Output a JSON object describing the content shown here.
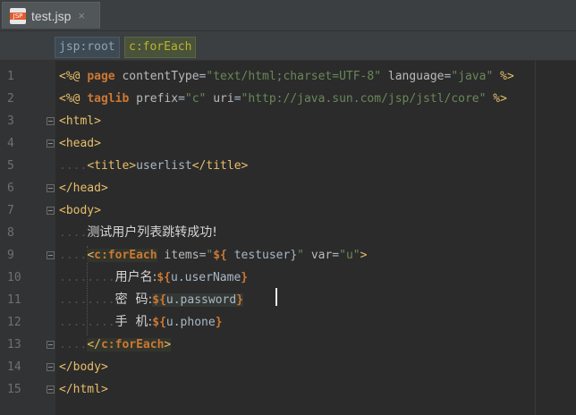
{
  "tab": {
    "file_icon_badge": "JSP",
    "filename": "test.jsp",
    "close": "×"
  },
  "breadcrumbs": [
    "jsp:root",
    "c:forEach"
  ],
  "line_numbers": [
    "1",
    "2",
    "3",
    "4",
    "5",
    "6",
    "7",
    "8",
    "9",
    "10",
    "11",
    "12",
    "13",
    "14",
    "15"
  ],
  "code": {
    "l1": {
      "open": "<%@",
      "kw": "page",
      "a1": "contentType",
      "v1": "\"text/html;charset=UTF-8\"",
      "a2": "language",
      "v2": "\"java\"",
      "close": "%>"
    },
    "l2": {
      "open": "<%@",
      "kw": "taglib",
      "a1": "prefix",
      "v1": "\"c\"",
      "a2": "uri",
      "v2": "\"http://java.sun.com/jsp/jstl/core\"",
      "close": "%>"
    },
    "l3": "<html>",
    "l4": "<head>",
    "l5_open": "<title>",
    "l5_text": "userlist",
    "l5_close": "</title>",
    "l6": "</head>",
    "l7": "<body>",
    "l8": "测试用户列表跳转成功!",
    "l9": {
      "lt": "<",
      "prefix": "c:",
      "tag": "forEach",
      "a1": "items",
      "eq": "=",
      "v1_q": "\"",
      "v1_el": "${",
      "v1_body": " testuser}",
      "v1_q2": "\"",
      "a2": "var",
      "v2": "\"u\"",
      "gt": ">"
    },
    "l10": {
      "label": "用户名:",
      "el": "${",
      "body": "u.userName",
      "end": "}"
    },
    "l11": {
      "label": "密  码:",
      "el": "${",
      "body": "u.password",
      "end": "}"
    },
    "l12": {
      "label": "手  机:",
      "el": "${",
      "body": "u.phone",
      "end": "}"
    },
    "l13": {
      "lt": "</",
      "prefix": "c:",
      "tag": "forEach",
      "gt": ">"
    },
    "l14": "</body>",
    "l15": "</html>"
  },
  "colors": {
    "background": "#2B2B2B",
    "gutter": "#313335",
    "tag": "#E8BF6A",
    "keyword": "#CC7832",
    "string": "#6A8759",
    "attribute": "#BABABA",
    "tab_badge": "#E25C2D"
  }
}
